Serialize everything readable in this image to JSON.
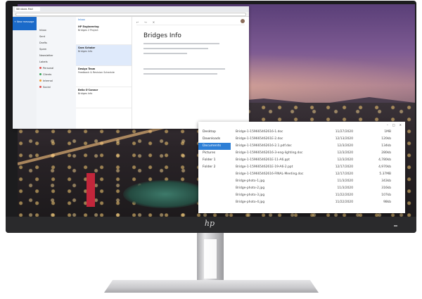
{
  "screen": {
    "mail_window": {
      "tab_title": "Windows Mail",
      "new_message": "New message",
      "inbox_header": "Inbox",
      "folders": [
        {
          "label": "Inbox",
          "color": ""
        },
        {
          "label": "Sent",
          "color": ""
        },
        {
          "label": "Drafts",
          "color": ""
        },
        {
          "label": "Spam",
          "color": ""
        },
        {
          "label": "Newsletter",
          "color": ""
        },
        {
          "label": "Labels",
          "color": ""
        },
        {
          "label": "Personal",
          "color": "#e0524e"
        },
        {
          "label": "Clients",
          "color": "#3aa35b"
        },
        {
          "label": "Internal",
          "color": "#f0a030"
        },
        {
          "label": "Social",
          "color": "#e0524e"
        }
      ],
      "messages": [
        {
          "from": "HP Engineering",
          "subject": "Bridges 2 Project",
          "selected": false
        },
        {
          "from": "Sara Scholar",
          "subject": "Bridges Info",
          "selected": true
        },
        {
          "from": "Design Team",
          "subject": "Feedback & Revision Schedule",
          "selected": false
        },
        {
          "from": "Bella O'Connor",
          "subject": "Bridges Info",
          "selected": false
        }
      ],
      "reader_title": "Bridges Info"
    },
    "files_window": {
      "nav_items": [
        {
          "label": "Desktop",
          "active": false
        },
        {
          "label": "Downloads",
          "active": false
        },
        {
          "label": "Documents",
          "active": true
        },
        {
          "label": "Pictures",
          "active": false
        },
        {
          "label": "Folder 1",
          "active": false
        },
        {
          "label": "Folder 2",
          "active": false
        }
      ],
      "rows": [
        {
          "name": "Bridge-1-159665462616-1.doc",
          "date": "11/27/2020",
          "size": "1MB"
        },
        {
          "name": "Bridge-1-15966546261E-2.doc",
          "date": "12/13/2020",
          "size": "120kb"
        },
        {
          "name": "Bridge-1-159665462616-2.1.pdf.doc",
          "date": "12/3/2020",
          "size": "134kb"
        },
        {
          "name": "Bridge-1-159665462616-3-eng-lighting.doc",
          "date": "12/3/2020",
          "size": "280kb"
        },
        {
          "name": "Bridge-1-15966546261E-11-A6.ppt",
          "date": "12/3/2020",
          "size": "4,780kb"
        },
        {
          "name": "Bridge-1-15966546261E-19-A6-2.ppt",
          "date": "12/17/2020",
          "size": "4,970kb"
        },
        {
          "name": "Bridge-1-159665462616-FINAL-Meeting.doc",
          "date": "12/17/2020",
          "size": "5.37MB"
        },
        {
          "name": "Bridge-photo-1.jpg",
          "date": "11/3/2020",
          "size": "343kb"
        },
        {
          "name": "Bridge-photo-2.jpg",
          "date": "11/3/2020",
          "size": "316kb"
        },
        {
          "name": "Bridge-photo-3.jpg",
          "date": "11/22/2020",
          "size": "107kb"
        },
        {
          "name": "Bridge-photo-4.jpg",
          "date": "11/22/2020",
          "size": "98kb"
        }
      ]
    }
  },
  "brand": {
    "logo_text": "hp"
  },
  "colors": {
    "bezel": "#1c1c1e",
    "accent_blue": "#2e7fd6",
    "stand_silver": "#cfcfd2"
  }
}
